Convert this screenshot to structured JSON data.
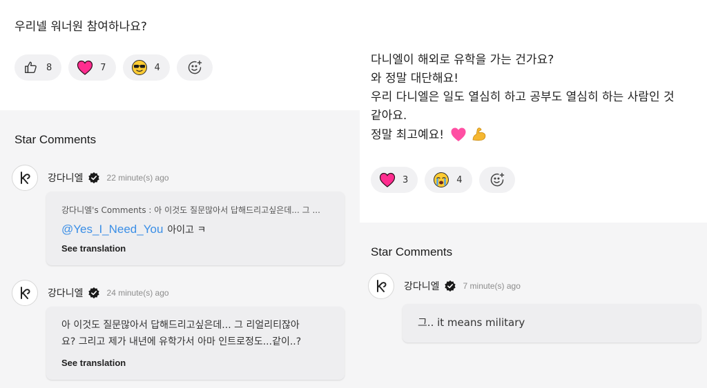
{
  "left": {
    "post_text": "우리넬 워너원 참여하나요?",
    "reactions": [
      {
        "icon": "thumbs-up-icon",
        "count": "8"
      },
      {
        "icon": "heart-icon",
        "count": "7"
      },
      {
        "icon": "sunglasses-face-icon",
        "count": "4"
      }
    ],
    "add_reaction_icon": "add-reaction-icon",
    "section_title": "Star Comments",
    "comments": [
      {
        "author": "강다니엘",
        "time": "22 minute(s) ago",
        "quote": "강다니엘's Comments : 아 이것도 질문많아서 답해드리고싶은데... 그 ...",
        "mention": "@Yes_I_Need_You",
        "text": "아이고 ㅋ",
        "see_translation": "See translation"
      },
      {
        "author": "강다니엘",
        "time": "24 minute(s) ago",
        "lines": [
          "아 이것도 질문많아서 답해드리고싶은데... 그 리얼리티잖아",
          "요? 그리고 제가 내년에 유학가서 아마 인트로정도...같이..?"
        ],
        "see_translation": "See translation"
      }
    ]
  },
  "right": {
    "post_lines": [
      "다니엘이 해외로 유학을 가는 건가요?",
      "와 정말 대단해요!",
      "우리 다니엘은 일도 열심히 하고 공부도 열심히 하는 사람인 것",
      "같아요.",
      "정말 최고예요!"
    ],
    "post_emojis": [
      "pink-heart-icon",
      "flexed-biceps-icon"
    ],
    "reactions": [
      {
        "icon": "heart-icon",
        "count": "3"
      },
      {
        "icon": "crying-face-icon",
        "count": "4"
      }
    ],
    "add_reaction_icon": "add-reaction-icon",
    "section_title": "Star Comments",
    "comment": {
      "author": "강다니엘",
      "time": "7 minute(s) ago",
      "text": "그.. it means military"
    }
  },
  "colors": {
    "mention": "#3a8ee6",
    "heart": "#ff2d8f",
    "chip_bg": "#f1f1f3",
    "section_bg": "#f5f5f6",
    "bubble_bg": "#eeeef0"
  }
}
